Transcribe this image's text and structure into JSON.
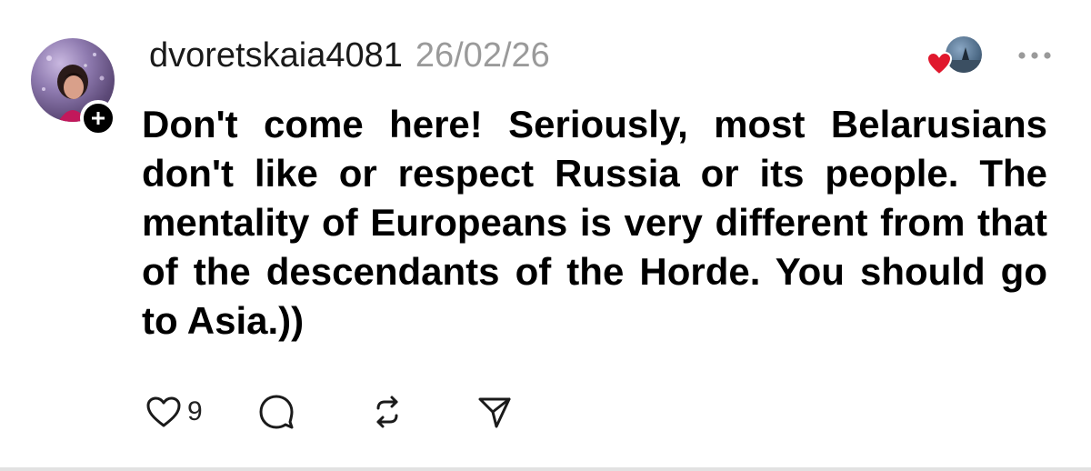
{
  "post": {
    "username": "dvoretskaia4081",
    "date": "26/02/26",
    "text": "Don't come here! Seriously, most Belarusians don't like or respect Russia or its people. The mentality of Europeans is very different from that of the descendants of the Horde. You should go to Asia.))",
    "like_count": "9"
  },
  "icons": {
    "avatar": "user-avatar",
    "follow": "plus-icon",
    "reply_heart": "heart-icon",
    "more": "more-dots-icon",
    "like": "heart-outline-icon",
    "comment": "comment-icon",
    "repost": "repost-icon",
    "share": "send-icon"
  },
  "colors": {
    "text": "#000000",
    "date": "#9a9a9a",
    "heart_red": "#e0182d",
    "icon": "#1a1a1a"
  }
}
